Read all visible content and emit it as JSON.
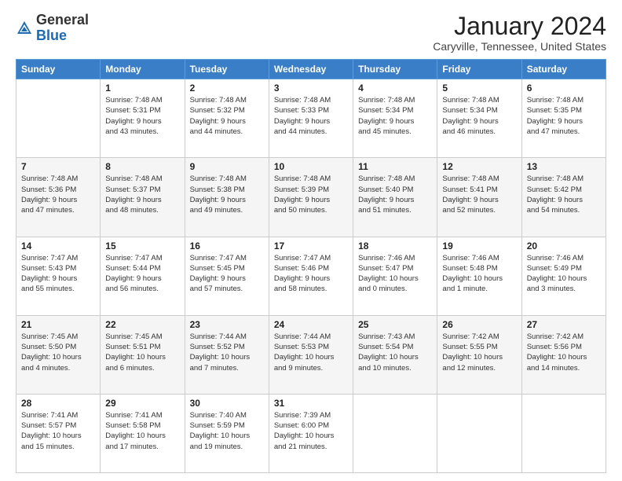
{
  "logo": {
    "general": "General",
    "blue": "Blue"
  },
  "header": {
    "month": "January 2024",
    "location": "Caryville, Tennessee, United States"
  },
  "weekdays": [
    "Sunday",
    "Monday",
    "Tuesday",
    "Wednesday",
    "Thursday",
    "Friday",
    "Saturday"
  ],
  "weeks": [
    [
      {
        "day": "",
        "info": ""
      },
      {
        "day": "1",
        "info": "Sunrise: 7:48 AM\nSunset: 5:31 PM\nDaylight: 9 hours\nand 43 minutes."
      },
      {
        "day": "2",
        "info": "Sunrise: 7:48 AM\nSunset: 5:32 PM\nDaylight: 9 hours\nand 44 minutes."
      },
      {
        "day": "3",
        "info": "Sunrise: 7:48 AM\nSunset: 5:33 PM\nDaylight: 9 hours\nand 44 minutes."
      },
      {
        "day": "4",
        "info": "Sunrise: 7:48 AM\nSunset: 5:34 PM\nDaylight: 9 hours\nand 45 minutes."
      },
      {
        "day": "5",
        "info": "Sunrise: 7:48 AM\nSunset: 5:34 PM\nDaylight: 9 hours\nand 46 minutes."
      },
      {
        "day": "6",
        "info": "Sunrise: 7:48 AM\nSunset: 5:35 PM\nDaylight: 9 hours\nand 47 minutes."
      }
    ],
    [
      {
        "day": "7",
        "info": "Sunrise: 7:48 AM\nSunset: 5:36 PM\nDaylight: 9 hours\nand 47 minutes."
      },
      {
        "day": "8",
        "info": "Sunrise: 7:48 AM\nSunset: 5:37 PM\nDaylight: 9 hours\nand 48 minutes."
      },
      {
        "day": "9",
        "info": "Sunrise: 7:48 AM\nSunset: 5:38 PM\nDaylight: 9 hours\nand 49 minutes."
      },
      {
        "day": "10",
        "info": "Sunrise: 7:48 AM\nSunset: 5:39 PM\nDaylight: 9 hours\nand 50 minutes."
      },
      {
        "day": "11",
        "info": "Sunrise: 7:48 AM\nSunset: 5:40 PM\nDaylight: 9 hours\nand 51 minutes."
      },
      {
        "day": "12",
        "info": "Sunrise: 7:48 AM\nSunset: 5:41 PM\nDaylight: 9 hours\nand 52 minutes."
      },
      {
        "day": "13",
        "info": "Sunrise: 7:48 AM\nSunset: 5:42 PM\nDaylight: 9 hours\nand 54 minutes."
      }
    ],
    [
      {
        "day": "14",
        "info": "Sunrise: 7:47 AM\nSunset: 5:43 PM\nDaylight: 9 hours\nand 55 minutes."
      },
      {
        "day": "15",
        "info": "Sunrise: 7:47 AM\nSunset: 5:44 PM\nDaylight: 9 hours\nand 56 minutes."
      },
      {
        "day": "16",
        "info": "Sunrise: 7:47 AM\nSunset: 5:45 PM\nDaylight: 9 hours\nand 57 minutes."
      },
      {
        "day": "17",
        "info": "Sunrise: 7:47 AM\nSunset: 5:46 PM\nDaylight: 9 hours\nand 58 minutes."
      },
      {
        "day": "18",
        "info": "Sunrise: 7:46 AM\nSunset: 5:47 PM\nDaylight: 10 hours\nand 0 minutes."
      },
      {
        "day": "19",
        "info": "Sunrise: 7:46 AM\nSunset: 5:48 PM\nDaylight: 10 hours\nand 1 minute."
      },
      {
        "day": "20",
        "info": "Sunrise: 7:46 AM\nSunset: 5:49 PM\nDaylight: 10 hours\nand 3 minutes."
      }
    ],
    [
      {
        "day": "21",
        "info": "Sunrise: 7:45 AM\nSunset: 5:50 PM\nDaylight: 10 hours\nand 4 minutes."
      },
      {
        "day": "22",
        "info": "Sunrise: 7:45 AM\nSunset: 5:51 PM\nDaylight: 10 hours\nand 6 minutes."
      },
      {
        "day": "23",
        "info": "Sunrise: 7:44 AM\nSunset: 5:52 PM\nDaylight: 10 hours\nand 7 minutes."
      },
      {
        "day": "24",
        "info": "Sunrise: 7:44 AM\nSunset: 5:53 PM\nDaylight: 10 hours\nand 9 minutes."
      },
      {
        "day": "25",
        "info": "Sunrise: 7:43 AM\nSunset: 5:54 PM\nDaylight: 10 hours\nand 10 minutes."
      },
      {
        "day": "26",
        "info": "Sunrise: 7:42 AM\nSunset: 5:55 PM\nDaylight: 10 hours\nand 12 minutes."
      },
      {
        "day": "27",
        "info": "Sunrise: 7:42 AM\nSunset: 5:56 PM\nDaylight: 10 hours\nand 14 minutes."
      }
    ],
    [
      {
        "day": "28",
        "info": "Sunrise: 7:41 AM\nSunset: 5:57 PM\nDaylight: 10 hours\nand 15 minutes."
      },
      {
        "day": "29",
        "info": "Sunrise: 7:41 AM\nSunset: 5:58 PM\nDaylight: 10 hours\nand 17 minutes."
      },
      {
        "day": "30",
        "info": "Sunrise: 7:40 AM\nSunset: 5:59 PM\nDaylight: 10 hours\nand 19 minutes."
      },
      {
        "day": "31",
        "info": "Sunrise: 7:39 AM\nSunset: 6:00 PM\nDaylight: 10 hours\nand 21 minutes."
      },
      {
        "day": "",
        "info": ""
      },
      {
        "day": "",
        "info": ""
      },
      {
        "day": "",
        "info": ""
      }
    ]
  ]
}
